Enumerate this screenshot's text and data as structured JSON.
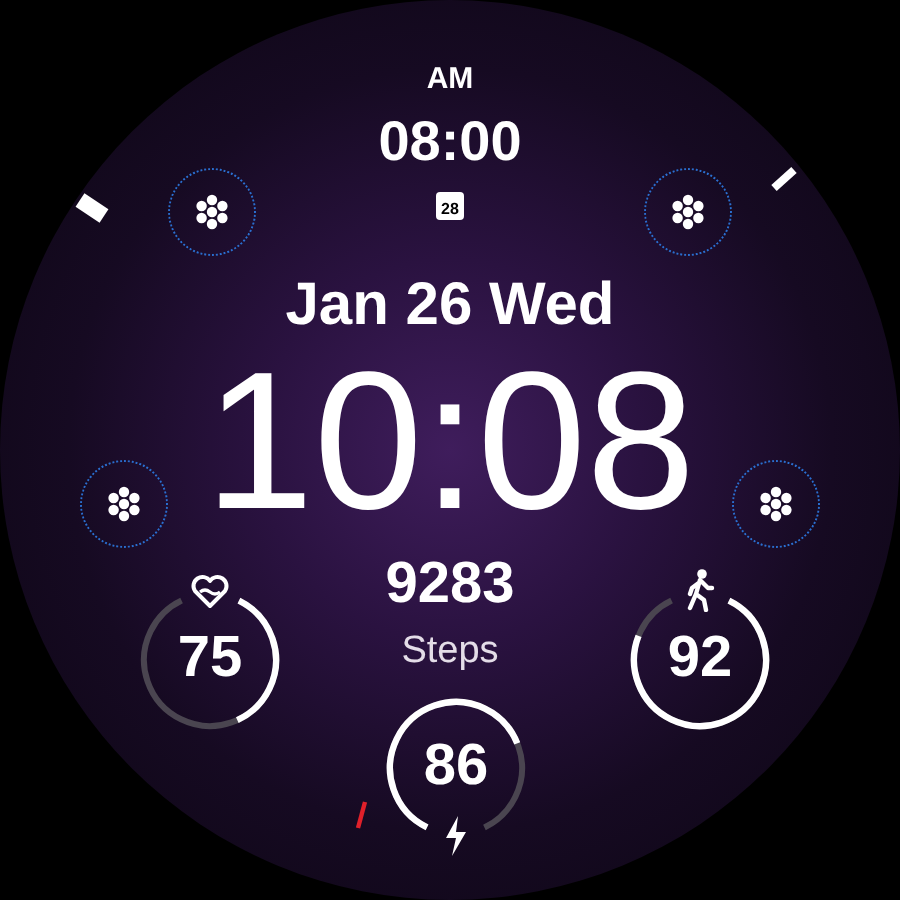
{
  "top_complication": {
    "period": "AM",
    "time": "08:00",
    "calendar_day": "28"
  },
  "date": "Jan 26 Wed",
  "time": "10:08",
  "steps": {
    "value": "9283",
    "label": "Steps"
  },
  "rings": [
    {
      "kind": "heart",
      "value": "75",
      "level": 0.42
    },
    {
      "kind": "steps",
      "value": "92",
      "level": 0.86
    },
    {
      "kind": "battery",
      "value": "86",
      "level": 0.72
    }
  ]
}
